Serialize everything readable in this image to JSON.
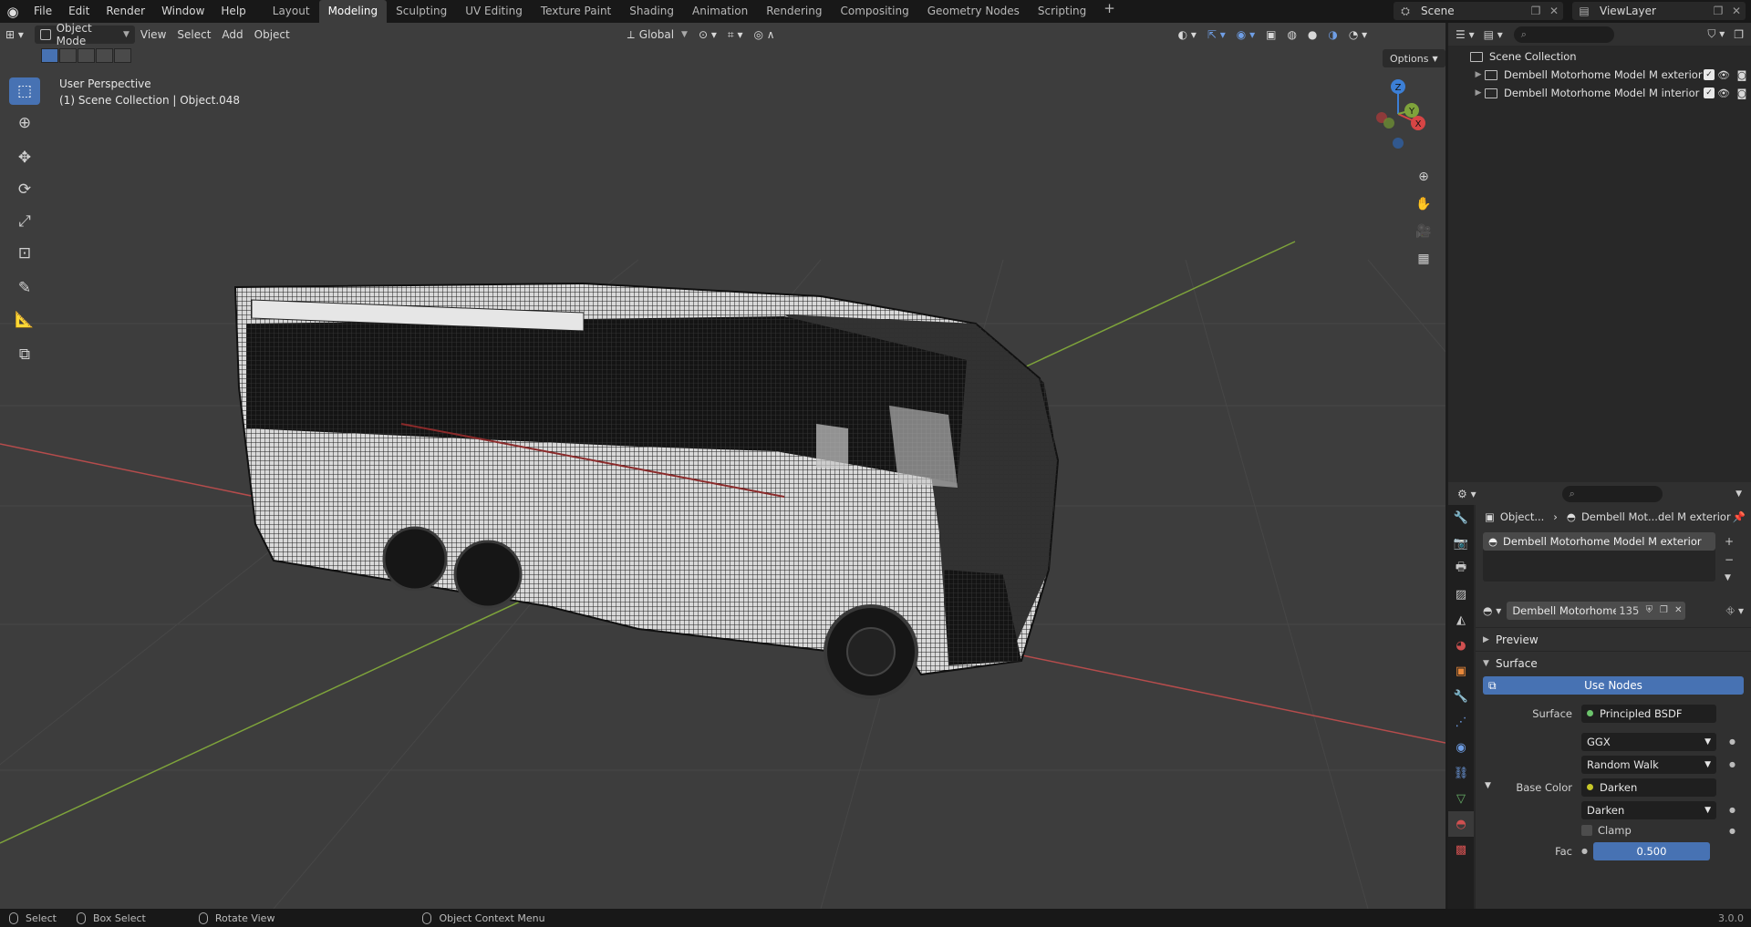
{
  "menu": [
    "File",
    "Edit",
    "Render",
    "Window",
    "Help"
  ],
  "workspaces": [
    "Layout",
    "Modeling",
    "Sculpting",
    "UV Editing",
    "Texture Paint",
    "Shading",
    "Animation",
    "Rendering",
    "Compositing",
    "Geometry Nodes",
    "Scripting"
  ],
  "active_workspace": "Modeling",
  "scene": "Scene",
  "view_layer": "ViewLayer",
  "viewport": {
    "mode": "Object Mode",
    "menus": [
      "View",
      "Select",
      "Add",
      "Object"
    ],
    "orientation": "Global",
    "options": "Options",
    "view_name": "User Perspective",
    "context": "(1) Scene Collection | Object.048",
    "axis_x": "X",
    "axis_y": "Y",
    "axis_z": "Z",
    "grid_x_color": "#b54c4c",
    "grid_y_color": "#7ea33b"
  },
  "outliner": {
    "root": "Scene Collection",
    "collections": [
      "Dembell Motorhome Model M exterior",
      "Dembell Motorhome Model M  interior"
    ]
  },
  "properties": {
    "breadcrumb_object": "Object...",
    "breadcrumb_material": "Dembell Mot...del M exterior",
    "slot": "Dembell Motorhome Model M exterior",
    "material_name": "Dembell Motorhome...",
    "material_users": "135",
    "preview_label": "Preview",
    "surface_panel": "Surface",
    "use_nodes": "Use Nodes",
    "surface_label": "Surface",
    "surface_value": "Principled BSDF",
    "distribution": "GGX",
    "subsurface": "Random Walk",
    "base_color_label": "Base Color",
    "base_color_value": "Darken",
    "blend_mode": "Darken",
    "clamp_label": "Clamp",
    "fac_label": "Fac",
    "fac_value": "0.500"
  },
  "status": {
    "select": "Select",
    "box_select": "Box Select",
    "rotate_view": "Rotate View",
    "context_menu": "Object Context Menu",
    "version": "3.0.0"
  }
}
